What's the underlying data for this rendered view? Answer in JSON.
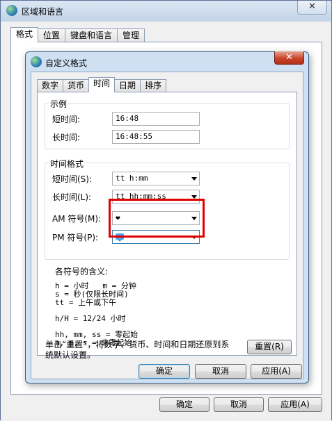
{
  "parent": {
    "title": "区域和语言",
    "close_glyph": "✕",
    "tabs": [
      "格式",
      "位置",
      "键盘和语言",
      "管理"
    ],
    "ok_label": "确定",
    "cancel_label": "取消",
    "apply_label": "应用(A)"
  },
  "dialog": {
    "title": "自定义格式",
    "close_glyph": "✕",
    "tabs": [
      "数字",
      "货币",
      "时间",
      "日期",
      "排序"
    ],
    "active_tab": "时间",
    "example": {
      "legend": "示例",
      "short_time_label": "短时间:",
      "short_time_value": "16:48",
      "long_time_label": "长时间:",
      "long_time_value": "16:48:55"
    },
    "time_formats": {
      "legend": "时间格式",
      "short_time_label": "短时间(S):",
      "short_time_value": "tt h:mm",
      "long_time_label": "长时间(L):",
      "long_time_value": "tt hh:mm:ss",
      "am_label": "AM 符号(M):",
      "am_value": "❤",
      "pm_label": "PM 符号(P):",
      "pm_value": ""
    },
    "notes": {
      "title": "各符号的含义:",
      "line1": "h = 小时   m = 分钟",
      "line2": "s = 秒(仅限长时间)",
      "line3": "tt = 上午或下午",
      "line4": "h/H = 12/24 小时",
      "line5": "hh, mm, ss = 零起始",
      "line6": "h, m, s = 非零起始"
    },
    "reset_text_line1": "单击“重置”，将数字、货币、时间和日期还原到系",
    "reset_text_line2": "统默认设置。",
    "reset_button": "重置(R)",
    "ok_label": "确定",
    "cancel_label": "取消",
    "apply_label": "应用(A)"
  }
}
